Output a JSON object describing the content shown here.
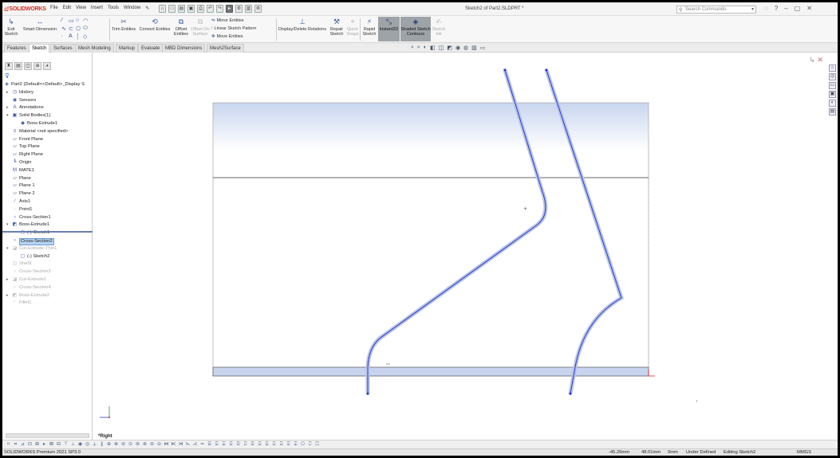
{
  "app": {
    "brand": "SOLIDWORKS",
    "doc_title": "Sketch2 of Part2.SLDPRT *",
    "menu": [
      "File",
      "Edit",
      "View",
      "Insert",
      "Tools",
      "Window"
    ],
    "search_placeholder": "Search Commands"
  },
  "command_manager": {
    "exit_sketch": "Exit Sketch",
    "smart_dimension": "Smart Dimension",
    "trim_entities": "Trim Entities",
    "convert_entities": "Convert Entities",
    "offset_entities": "Offset Entities",
    "offset_on_surface": "Offset On Surface",
    "mirror_entities": "Mirror Entities",
    "linear_pattern": "Linear Sketch Pattern",
    "move_entities": "Move Entities",
    "display_delete_relations": "Display/Delete Relations",
    "repair_sketch": "Repair Sketch",
    "quick_snaps": "Quick Snaps",
    "rapid_sketch": "Rapid Sketch",
    "instant2d": "Instant2D",
    "shaded_contours": "Shaded Sketch Contours",
    "sketch_ink": "Sketch Ink"
  },
  "tabs": [
    "Features",
    "Sketch",
    "Surfaces",
    "Mesh Modeling",
    "Markup",
    "Evaluate",
    "MBD Dimensions",
    "Mesh2Surface"
  ],
  "active_tab": "Sketch",
  "tree": [
    {
      "label": "Part2  (Default<<Default>_Display S",
      "icon": "part-icon",
      "exp": "",
      "indent": 0
    },
    {
      "label": "History",
      "icon": "history-icon",
      "exp": "▸",
      "indent": 1
    },
    {
      "label": "Sensors",
      "icon": "sensor-icon",
      "exp": "",
      "indent": 1
    },
    {
      "label": "Annotations",
      "icon": "annotation-icon",
      "exp": "▸",
      "indent": 1
    },
    {
      "label": "Solid Bodies(1)",
      "icon": "solid-bodies-icon",
      "exp": "▾",
      "indent": 1
    },
    {
      "label": "Boss-Extrude1",
      "icon": "body-icon",
      "exp": "",
      "indent": 2
    },
    {
      "label": "Material <not specified>",
      "icon": "material-icon",
      "exp": "",
      "indent": 1
    },
    {
      "label": "Front Plane",
      "icon": "plane-icon",
      "exp": "",
      "indent": 1
    },
    {
      "label": "Top Plane",
      "icon": "plane-icon",
      "exp": "",
      "indent": 1
    },
    {
      "label": "Right Plane",
      "icon": "plane-icon",
      "exp": "",
      "indent": 1
    },
    {
      "label": "Origin",
      "icon": "origin-icon",
      "exp": "",
      "indent": 1
    },
    {
      "label": "MATE1",
      "icon": "mate-icon",
      "exp": "",
      "indent": 1
    },
    {
      "label": "Plane",
      "icon": "plane-icon",
      "exp": "",
      "indent": 1
    },
    {
      "label": "Plane 1",
      "icon": "plane-icon",
      "exp": "",
      "indent": 1
    },
    {
      "label": "Plane 2",
      "icon": "plane-icon",
      "exp": "",
      "indent": 1
    },
    {
      "label": "Axis1",
      "icon": "axis-icon",
      "exp": "",
      "indent": 1
    },
    {
      "label": "Point1",
      "icon": "point-icon",
      "exp": "",
      "indent": 1
    },
    {
      "label": "Cross-Section1",
      "icon": "cross-section-icon",
      "exp": "",
      "indent": 1
    },
    {
      "label": "Boss-Extrude1",
      "icon": "extrude-icon",
      "exp": "▾",
      "indent": 1
    },
    {
      "label": "(-) Sketch1",
      "icon": "sketch-icon",
      "exp": "",
      "indent": 2
    },
    {
      "label": "Cross-Section2",
      "icon": "cross-section-icon",
      "exp": "",
      "indent": 1,
      "selected": true
    },
    {
      "label": "Cut-Extrude-Thin1",
      "icon": "cut-extrude-icon",
      "exp": "▾",
      "indent": 1,
      "grey": true
    },
    {
      "label": "(-) Sketch2",
      "icon": "sketch-icon",
      "exp": "",
      "indent": 2
    },
    {
      "label": "Shell1",
      "icon": "shell-icon",
      "exp": "",
      "indent": 1,
      "grey": true
    },
    {
      "label": "Cross-Section3",
      "icon": "cross-section-icon",
      "exp": "",
      "indent": 1,
      "grey": true
    },
    {
      "label": "Cut-Extrude1",
      "icon": "cut-extrude-icon",
      "exp": "▸",
      "indent": 1,
      "grey": true
    },
    {
      "label": "Cross-Section4",
      "icon": "cross-section-icon",
      "exp": "",
      "indent": 1,
      "grey": true
    },
    {
      "label": "Boss-Extrude2",
      "icon": "extrude-icon",
      "exp": "▸",
      "indent": 1,
      "grey": true
    },
    {
      "label": "Fillet1",
      "icon": "fillet-icon",
      "exp": "",
      "indent": 1,
      "grey": true
    }
  ],
  "viewport": {
    "view_name": "*Right"
  },
  "status": {
    "product": "SOLIDWORKS Premium 2021 SP3.0",
    "x": "-45.26mm",
    "y": "48.01mm",
    "z": "0mm",
    "definition": "Under Defined",
    "editing": "Editing Sketch2",
    "units": "MMGS"
  },
  "colors": {
    "sketch_line": "#2b3bd1",
    "highlight": "#c9d6ef",
    "brand": "#d52b1e"
  }
}
